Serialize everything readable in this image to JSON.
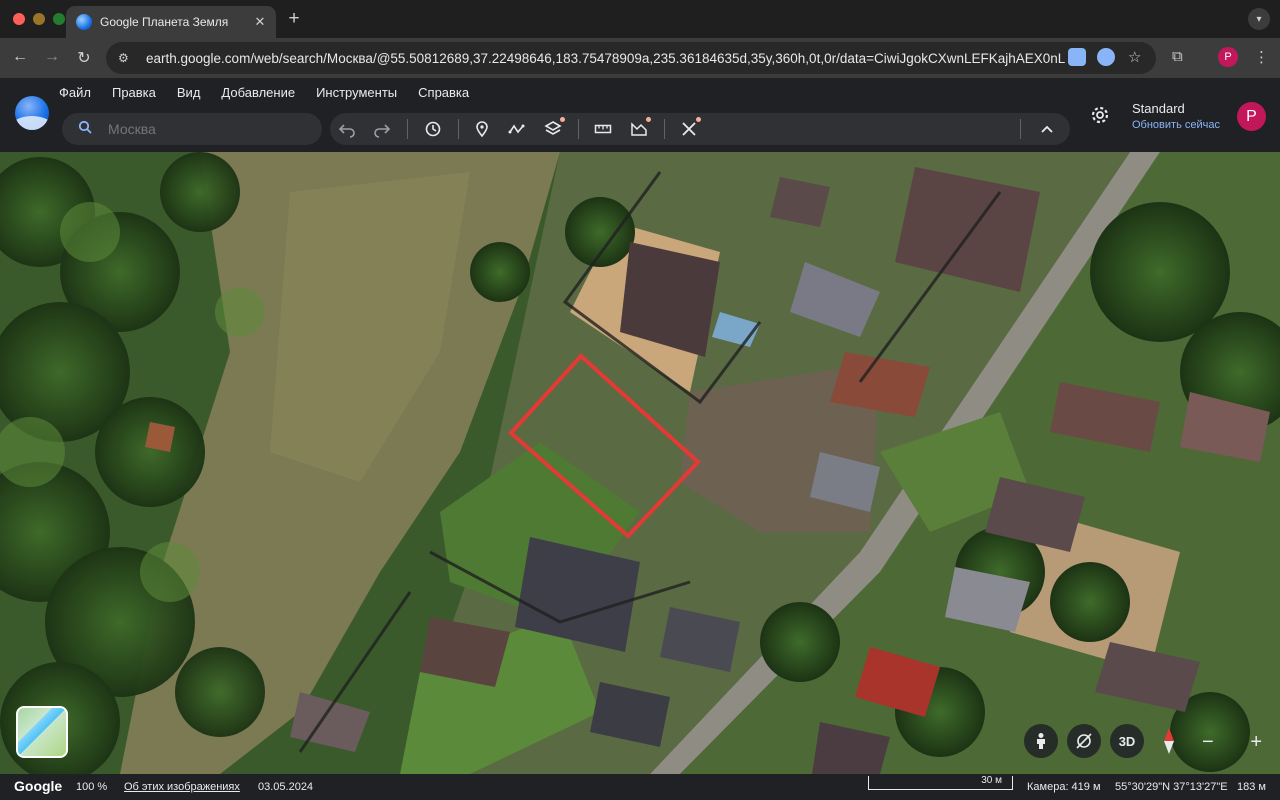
{
  "browser": {
    "tab_title": "Google Планета Земля",
    "tab_close": "✕",
    "new_tab": "+",
    "url": "earth.google.com/web/search/Москва/@55.50812689,37.22498646,183.75478909a,235.36184635d,35y,360h,0t,0r/data=CiwiJgokCXwnLEFKajhAEX0nL..."
  },
  "ge": {
    "menu": [
      "Файл",
      "Правка",
      "Вид",
      "Добавление",
      "Инструменты",
      "Справка"
    ],
    "search_placeholder": "Москва",
    "plan_name": "Standard",
    "plan_update": "Обновить сейчас",
    "avatar_letter": "P"
  },
  "map": {
    "highlight_color": "#e53935",
    "controls": {
      "view_3d": "3D",
      "zoom_out": "−",
      "zoom_in": "+"
    }
  },
  "status": {
    "brand": "Google",
    "zoom": "100 %",
    "about_imagery": "Об этих изображениях",
    "imagery_date": "03.05.2024",
    "scale": "30 м",
    "camera": "Камера: 419 м",
    "coords": "55°30'29\"N 37°13'27\"E",
    "elevation": "183 м"
  }
}
